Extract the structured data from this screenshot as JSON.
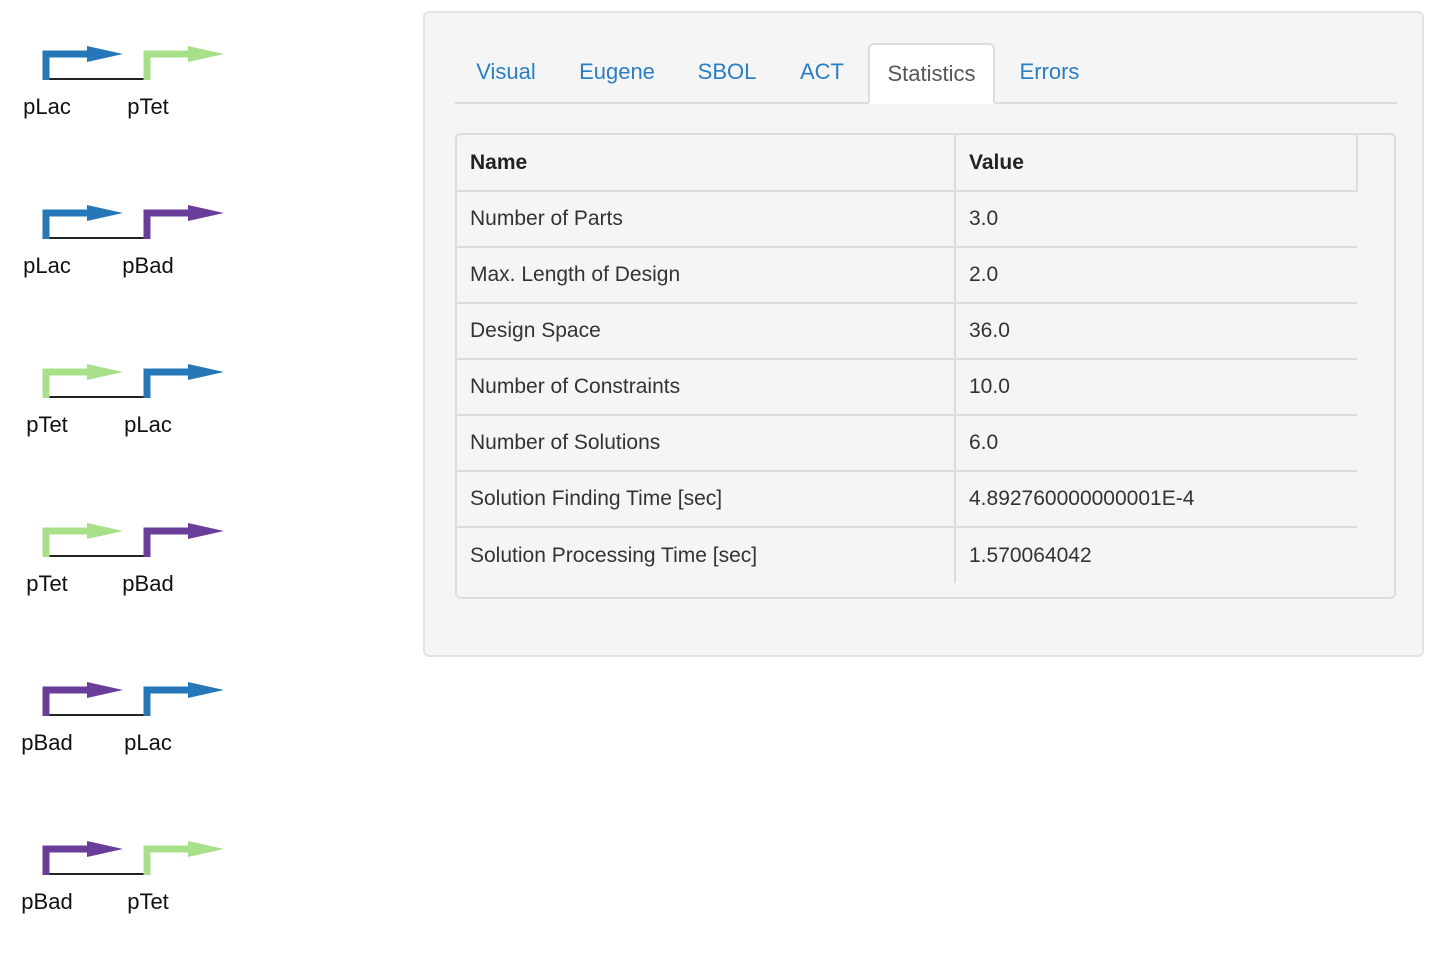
{
  "designs": [
    {
      "parts": [
        {
          "name": "pLac",
          "color": "#2677b8"
        },
        {
          "name": "pTet",
          "color": "#a8e08a"
        }
      ]
    },
    {
      "parts": [
        {
          "name": "pLac",
          "color": "#2677b8"
        },
        {
          "name": "pBad",
          "color": "#6a3d9a"
        }
      ]
    },
    {
      "parts": [
        {
          "name": "pTet",
          "color": "#a8e08a"
        },
        {
          "name": "pLac",
          "color": "#2677b8"
        }
      ]
    },
    {
      "parts": [
        {
          "name": "pTet",
          "color": "#a8e08a"
        },
        {
          "name": "pBad",
          "color": "#6a3d9a"
        }
      ]
    },
    {
      "parts": [
        {
          "name": "pBad",
          "color": "#6a3d9a"
        },
        {
          "name": "pLac",
          "color": "#2677b8"
        }
      ]
    },
    {
      "parts": [
        {
          "name": "pBad",
          "color": "#6a3d9a"
        },
        {
          "name": "pTet",
          "color": "#a8e08a"
        }
      ]
    }
  ],
  "tabs": [
    {
      "label": "Visual",
      "active": false
    },
    {
      "label": "Eugene",
      "active": false
    },
    {
      "label": "SBOL",
      "active": false
    },
    {
      "label": "ACT",
      "active": false
    },
    {
      "label": "Statistics",
      "active": true
    },
    {
      "label": "Errors",
      "active": false
    }
  ],
  "table": {
    "headers": [
      "Name",
      "Value"
    ],
    "rows": [
      [
        "Number of Parts",
        "3.0"
      ],
      [
        "Max. Length of Design",
        "2.0"
      ],
      [
        "Design Space",
        "36.0"
      ],
      [
        "Number of Constraints",
        "10.0"
      ],
      [
        "Number of Solutions",
        "6.0"
      ],
      [
        "Solution Finding Time [sec]",
        "4.892760000000001E-4"
      ],
      [
        "Solution Processing Time [sec]",
        "1.570064042"
      ]
    ]
  },
  "colors": {
    "link": "#2a7ec3",
    "backbone": "#222222"
  }
}
